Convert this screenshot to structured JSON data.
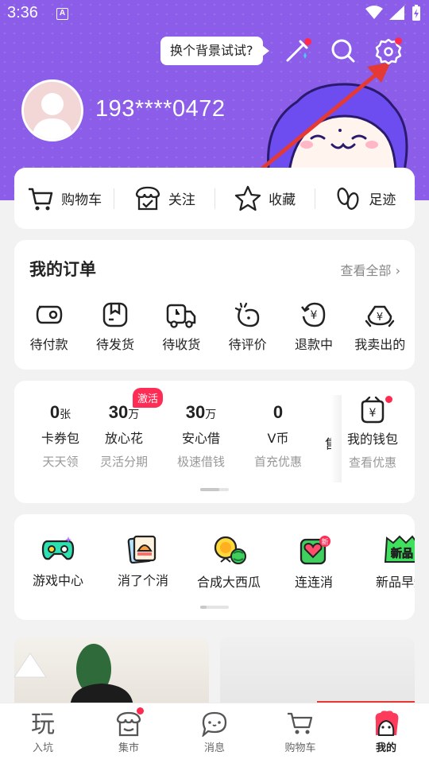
{
  "status_bar": {
    "time": "3:36",
    "notif_icon": "A"
  },
  "header": {
    "tooltip": "换个背景试试?",
    "icons": [
      "magic-wand-icon",
      "search-icon",
      "settings-gear-icon"
    ],
    "phone": "193****0472"
  },
  "quick_links": [
    {
      "label": "购物车",
      "icon": "cart-icon"
    },
    {
      "label": "关注",
      "icon": "store-follow-icon"
    },
    {
      "label": "收藏",
      "icon": "star-icon"
    },
    {
      "label": "足迹",
      "icon": "footprint-icon"
    }
  ],
  "orders": {
    "title": "我的订单",
    "view_all": "查看全部",
    "items": [
      {
        "label": "待付款",
        "icon": "wallet-pay-icon"
      },
      {
        "label": "待发货",
        "icon": "box-icon"
      },
      {
        "label": "待收货",
        "icon": "truck-icon"
      },
      {
        "label": "待评价",
        "icon": "review-icon"
      },
      {
        "label": "退款中",
        "icon": "refund-icon"
      },
      {
        "label": "我卖出的",
        "icon": "sold-icon"
      }
    ]
  },
  "wallet": {
    "badge": "激活",
    "items": [
      {
        "num": "0",
        "unit": "张",
        "name": "卡券包",
        "sub": "天天领"
      },
      {
        "num": "30",
        "unit": "万",
        "name": "放心花",
        "sub": "灵活分期"
      },
      {
        "num": "30",
        "unit": "万",
        "name": "安心借",
        "sub": "极速借钱"
      },
      {
        "num": "0",
        "unit": "",
        "name": "V币",
        "sub": "首充优惠"
      },
      {
        "num": "",
        "unit": "",
        "name": "我的钱包",
        "sub": "查看优惠"
      }
    ],
    "partial_glyph": "售"
  },
  "games": [
    {
      "label": "游戏中心",
      "icon": "gamepad-icon"
    },
    {
      "label": "消了个消",
      "icon": "cards-icon"
    },
    {
      "label": "合成大西瓜",
      "icon": "watermelon-icon"
    },
    {
      "label": "连连消",
      "icon": "connect-icon",
      "badge": "新"
    },
    {
      "label": "新品早知",
      "icon": "new-product-icon",
      "badge_text": "新品"
    }
  ],
  "bottom_nav": [
    {
      "label": "入坑",
      "icon": "play-icon"
    },
    {
      "label": "集市",
      "icon": "market-icon"
    },
    {
      "label": "消息",
      "icon": "message-icon"
    },
    {
      "label": "购物车",
      "icon": "cart-icon"
    },
    {
      "label": "我的",
      "icon": "profile-mascot-icon"
    }
  ],
  "colors": {
    "header_purple": "#8b5de8",
    "accent_red": "#ff2d55",
    "mascot_blue": "#6e4df0"
  }
}
